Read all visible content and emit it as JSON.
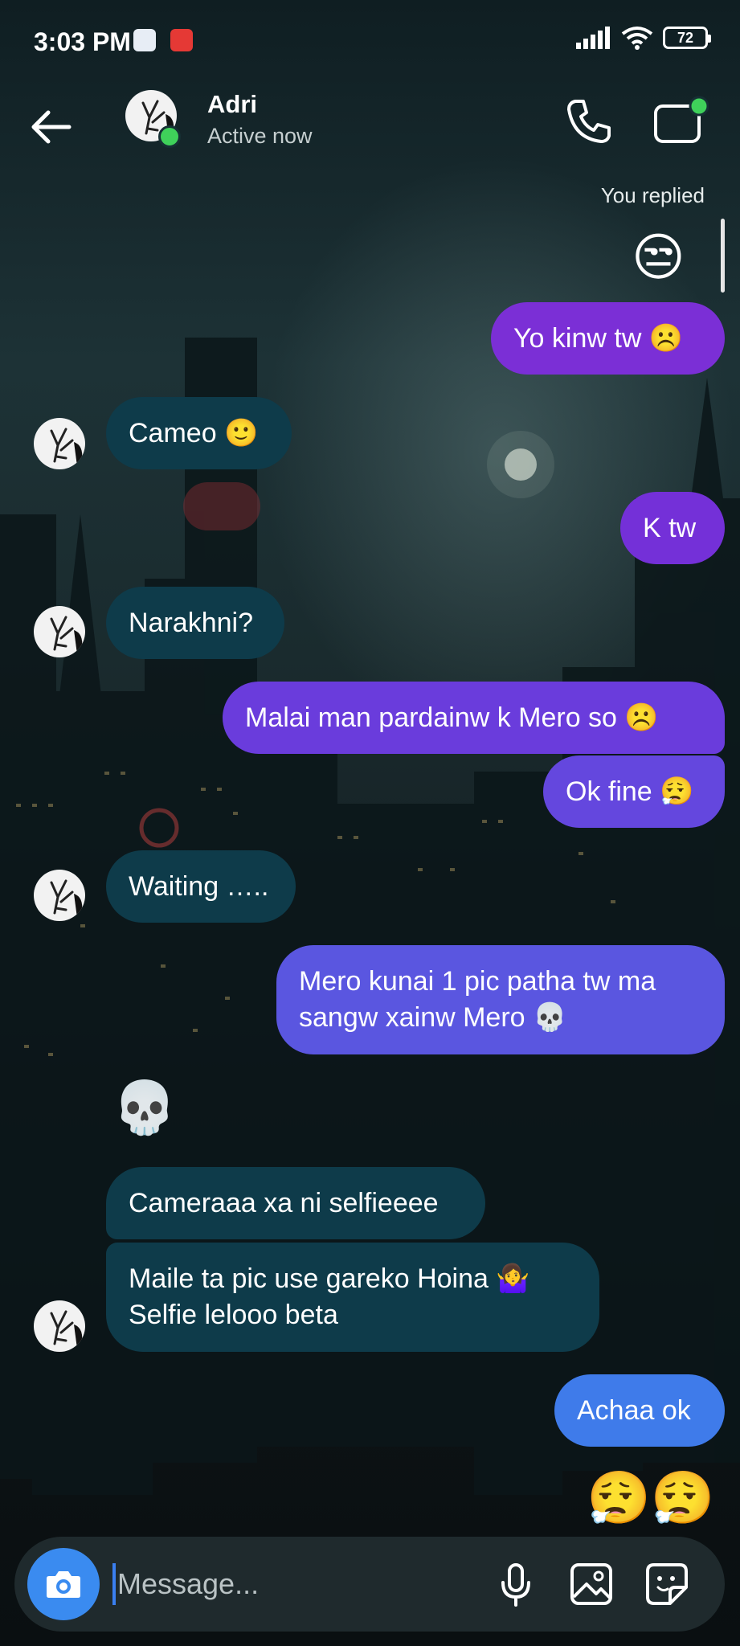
{
  "status_bar": {
    "time": "3:03 PM",
    "battery": "72"
  },
  "header": {
    "contact_name": "Adri",
    "contact_status": "Active now"
  },
  "reply_note": "You replied",
  "messages": [
    {
      "side": "out",
      "text": "😒",
      "kind": "emoji"
    },
    {
      "side": "out",
      "text": "Yo kinw tw ☹️"
    },
    {
      "side": "in",
      "text": "Cameo 🙂"
    },
    {
      "side": "out",
      "text": "K tw"
    },
    {
      "side": "in",
      "text": "Narakhni?"
    },
    {
      "side": "out",
      "text": "Malai man pardainw k Mero so ☹️"
    },
    {
      "side": "out",
      "text": "Ok fine 😮‍💨"
    },
    {
      "side": "in",
      "text": "Waiting ….."
    },
    {
      "side": "out",
      "text": "Mero kunai 1 pic patha tw ma sangw xainw Mero 💀"
    },
    {
      "side": "in",
      "text": "💀",
      "kind": "emoji"
    },
    {
      "side": "in",
      "text": "Cameraaa xa ni selfieeee"
    },
    {
      "side": "in",
      "text": "Maile ta pic use gareko Hoina 🤷‍♀️ Selfie lelooo beta"
    },
    {
      "side": "out",
      "text": "Achaa ok"
    },
    {
      "side": "out",
      "text": "😮‍💨😮‍💨",
      "kind": "emoji"
    }
  ],
  "composer": {
    "placeholder": "Message..."
  },
  "colors": {
    "bubble_in": "#0e3b4a",
    "bubble_out_purple": "#7b2fd6",
    "bubble_out_blue": "#3f7bea",
    "online": "#3fd15a",
    "camera_button": "#3a8bf0"
  },
  "icons": [
    "back-arrow-icon",
    "phone-icon",
    "video-call-icon",
    "camera-icon",
    "microphone-icon",
    "gallery-icon",
    "sticker-icon"
  ]
}
